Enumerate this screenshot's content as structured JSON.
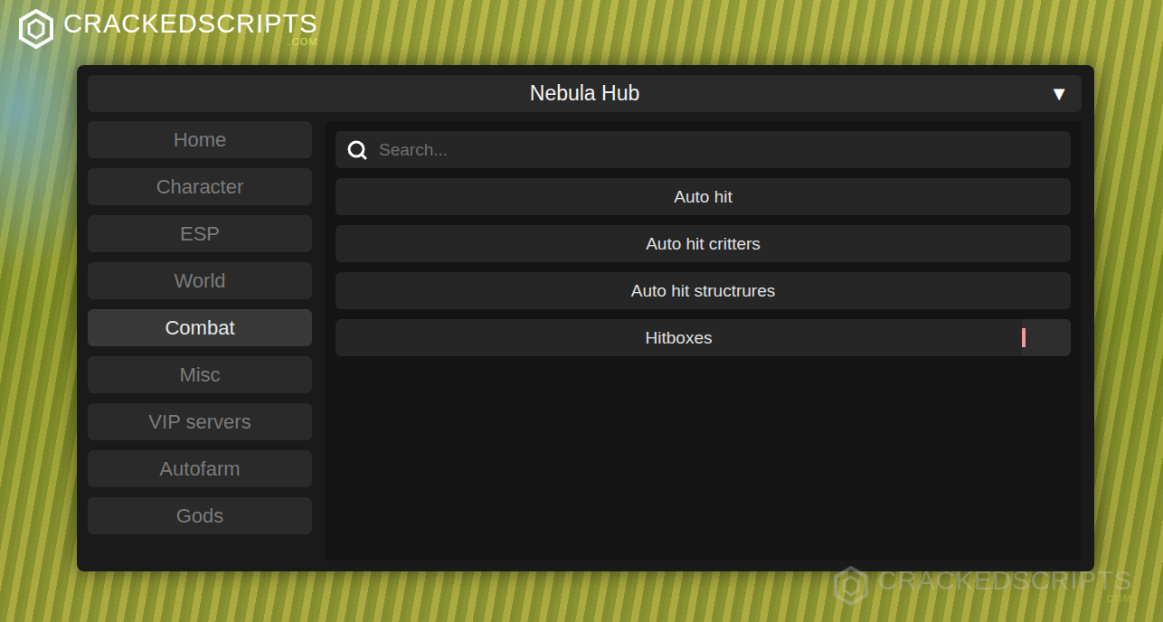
{
  "watermarks": [
    {
      "brand": "CRACKEDSCRIPTS",
      "domain": ".COM"
    },
    {
      "brand": "CRACKEDSCRIPTS",
      "domain": ".COM"
    }
  ],
  "window": {
    "title": "Nebula Hub",
    "collapse": "▼"
  },
  "sidebar": {
    "items": [
      {
        "label": "Home",
        "selected": false
      },
      {
        "label": "Character",
        "selected": false
      },
      {
        "label": "ESP",
        "selected": false
      },
      {
        "label": "World",
        "selected": false
      },
      {
        "label": "Combat",
        "selected": true
      },
      {
        "label": "Misc",
        "selected": false
      },
      {
        "label": "VIP servers",
        "selected": false
      },
      {
        "label": "Autofarm",
        "selected": false
      },
      {
        "label": "Gods",
        "selected": false
      }
    ]
  },
  "search": {
    "placeholder": "Search..."
  },
  "options": [
    {
      "label": "Auto hit",
      "kind": "button"
    },
    {
      "label": "Auto hit critters",
      "kind": "button"
    },
    {
      "label": "Auto hit structrures",
      "kind": "button"
    },
    {
      "label": "Hitboxes",
      "kind": "textbox"
    }
  ]
}
